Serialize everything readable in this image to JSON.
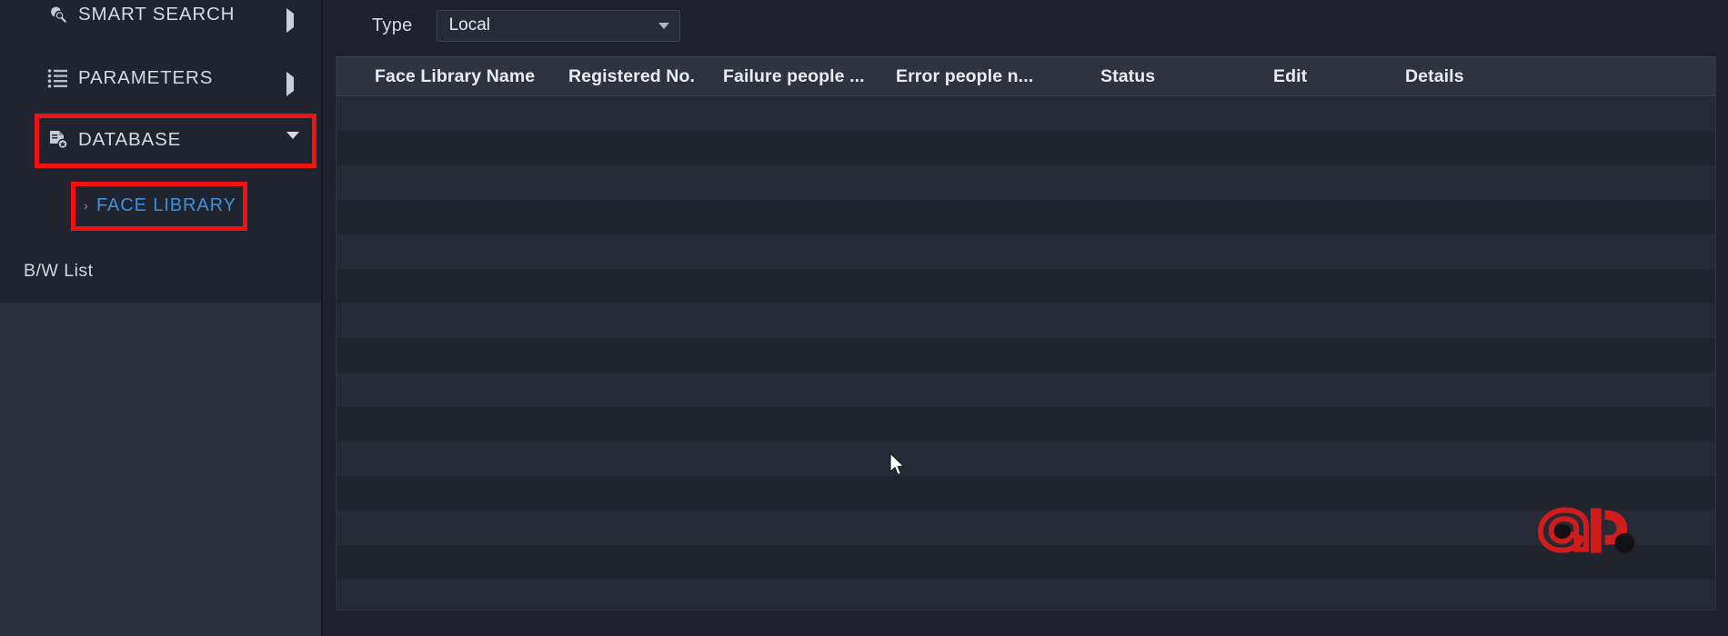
{
  "sidebar": {
    "items": [
      {
        "id": "smart-search",
        "label": "SMART SEARCH",
        "icon": "search-circle-icon",
        "arrow": "chevron-right-icon"
      },
      {
        "id": "parameters",
        "label": "PARAMETERS",
        "icon": "list-icon",
        "arrow": "chevron-right-icon"
      },
      {
        "id": "database",
        "label": "DATABASE",
        "icon": "database-file-icon",
        "arrow": "chevron-down-icon"
      }
    ],
    "sub_items": [
      {
        "id": "face-library",
        "label": "FACE LIBRARY",
        "selected": true,
        "chevron": "chevron-right-small-icon"
      },
      {
        "id": "bw-list",
        "label": "B/W List",
        "selected": false
      }
    ]
  },
  "content": {
    "type_filter": {
      "label": "Type",
      "value": "Local",
      "caret_icon": "chevron-down-icon"
    },
    "table": {
      "columns": [
        "Face Library Name",
        "Registered No.",
        "Failure people ...",
        "Error people n...",
        "Status",
        "Edit",
        "Details"
      ],
      "rows": [],
      "empty_row_count": 15
    }
  },
  "annotations": {
    "color": "#f01111",
    "boxes": [
      {
        "id": "database-highlight",
        "target": "DATABASE"
      },
      {
        "id": "face-library-highlight",
        "target": "FACE LIBRARY"
      }
    ]
  },
  "watermark": {
    "name": "dahua-logo-watermark",
    "color": "#e01b1b"
  }
}
